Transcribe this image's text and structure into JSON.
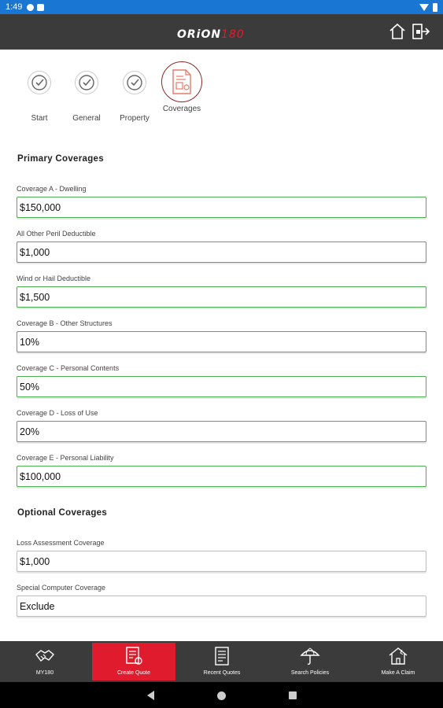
{
  "status_bar": {
    "time": "1:49"
  },
  "header": {
    "logo_main": "ORiON",
    "logo_accent": "180"
  },
  "stepper": {
    "steps": [
      {
        "label": "Start"
      },
      {
        "label": "General"
      },
      {
        "label": "Property"
      },
      {
        "label": "Coverages"
      }
    ]
  },
  "primary": {
    "title": "Primary Coverages",
    "fields": [
      {
        "label": "Coverage A - Dwelling",
        "value": "$150,000"
      },
      {
        "label": "All Other Peril Deductible",
        "value": "$1,000"
      },
      {
        "label": "Wind or Hail Deductible",
        "value": "$1,500"
      },
      {
        "label": "Coverage B - Other Structures",
        "value": "10%"
      },
      {
        "label": "Coverage C - Personal Contents",
        "value": "50%"
      },
      {
        "label": "Coverage D - Loss of Use",
        "value": "20%"
      },
      {
        "label": "Coverage E - Personal Liability",
        "value": "$100,000"
      }
    ]
  },
  "optional": {
    "title": "Optional Coverages",
    "fields": [
      {
        "label": "Loss Assessment Coverage",
        "value": "$1,000"
      },
      {
        "label": "Special Computer Coverage",
        "value": "Exclude"
      }
    ]
  },
  "bottom_nav": {
    "items": [
      {
        "label": "MY180",
        "icon": "handshake-icon"
      },
      {
        "label": "Create Quote",
        "icon": "quote-icon"
      },
      {
        "label": "Recent Quotes",
        "icon": "document-icon"
      },
      {
        "label": "Search Policies",
        "icon": "umbrella-icon"
      },
      {
        "label": "Make A Claim",
        "icon": "damaged-house-icon"
      }
    ]
  },
  "colors": {
    "status_bar": "#1976d2",
    "header": "#3b3b3b",
    "accent": "#e01b2e",
    "field_border": "#4caf50"
  }
}
